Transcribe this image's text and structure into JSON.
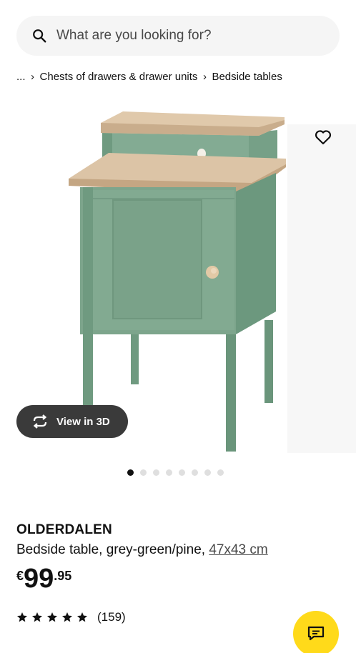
{
  "search": {
    "placeholder": "What are you looking for?"
  },
  "breadcrumb": {
    "ellipsis": "...",
    "items": [
      "Chests of drawers & drawer units",
      "Bedside tables"
    ]
  },
  "gallery": {
    "view_3d_label": "View in 3D",
    "image_count": 8,
    "active_index": 0
  },
  "product": {
    "name": "OLDERDALEN",
    "description": "Bedside table, grey-green/pine, ",
    "size": "47x43 cm",
    "price": {
      "currency": "€",
      "integer": "99",
      "decimal": ".95"
    },
    "rating": {
      "stars": 5,
      "count": "(159)"
    }
  },
  "icons": {
    "search": "search-icon",
    "favourite": "heart-icon",
    "view3d": "rotate-3d-icon",
    "chat": "chat-icon",
    "star": "star-icon"
  },
  "colors": {
    "chat_button": "#ffda1a",
    "view3d_button": "#3a3a3a",
    "search_bg": "#f5f5f5",
    "product_green": "#7da58c",
    "product_wood": "#dcc4a6"
  }
}
